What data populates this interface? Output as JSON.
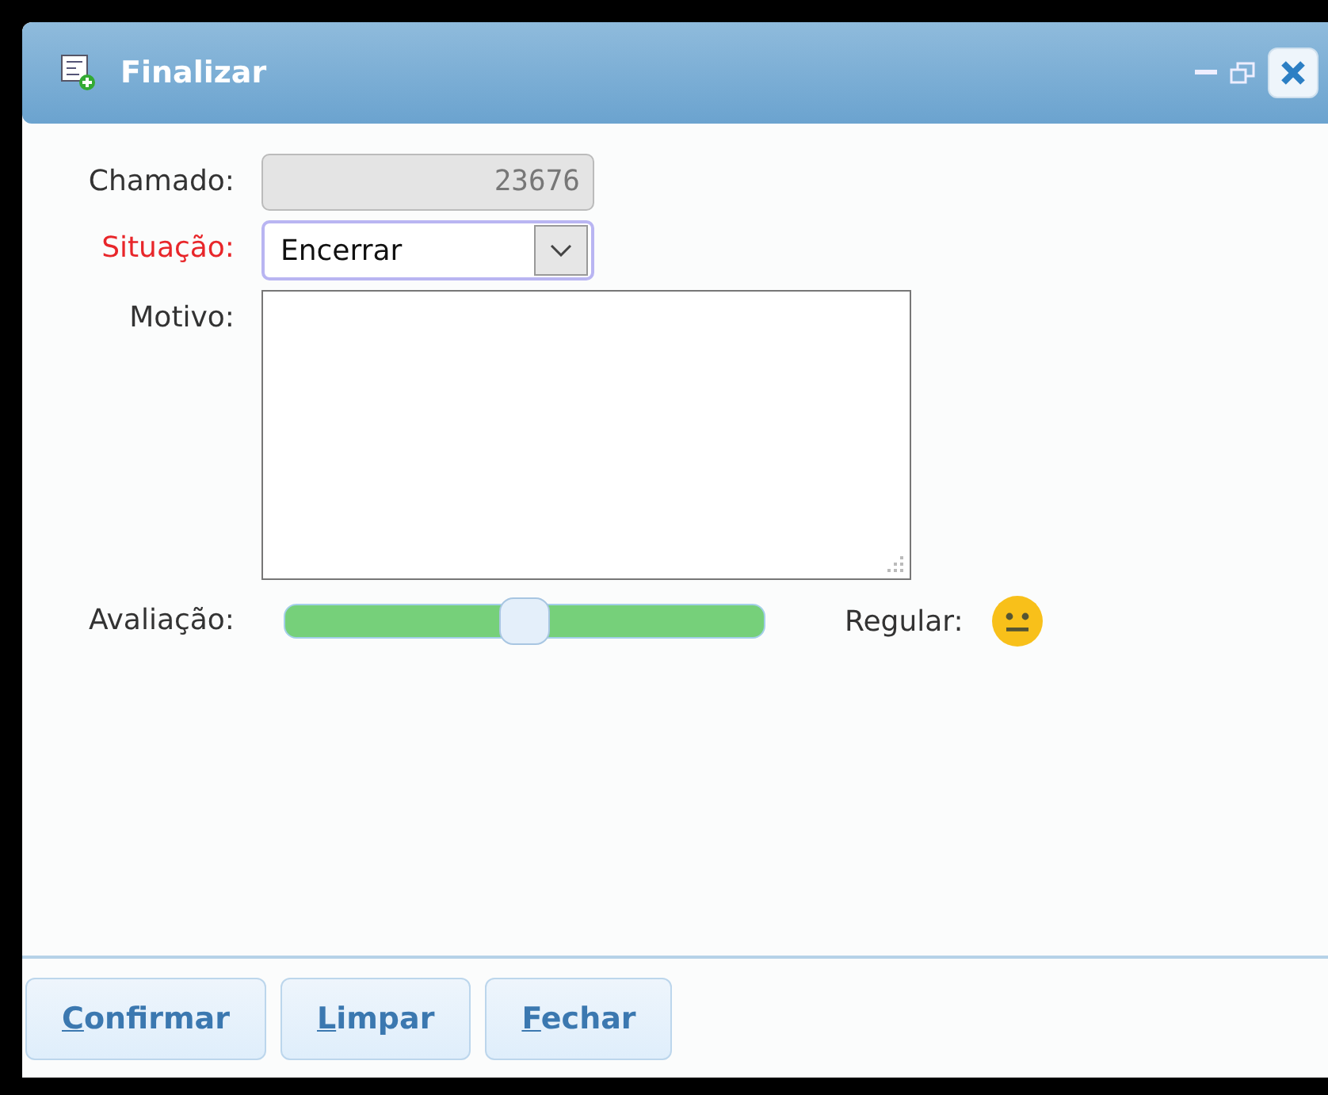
{
  "window": {
    "title": "Finalizar"
  },
  "fields": [
    {
      "kind": "readonly",
      "label": "Chamado:",
      "value": "23676",
      "required": false
    },
    {
      "kind": "select",
      "label": "Situação:",
      "value": "Encerrar",
      "required": true
    },
    {
      "kind": "textarea",
      "label": "Motivo:",
      "required": false
    }
  ],
  "rating": {
    "label": "Avaliação:",
    "level": 0.5,
    "reading": "Regular:"
  },
  "buttons": [
    {
      "label": "Confirmar",
      "mnemonic_underlined": true
    },
    {
      "label": "Limpar",
      "mnemonic_underlined": true
    },
    {
      "label": "Fechar",
      "mnemonic_underlined": true
    }
  ]
}
